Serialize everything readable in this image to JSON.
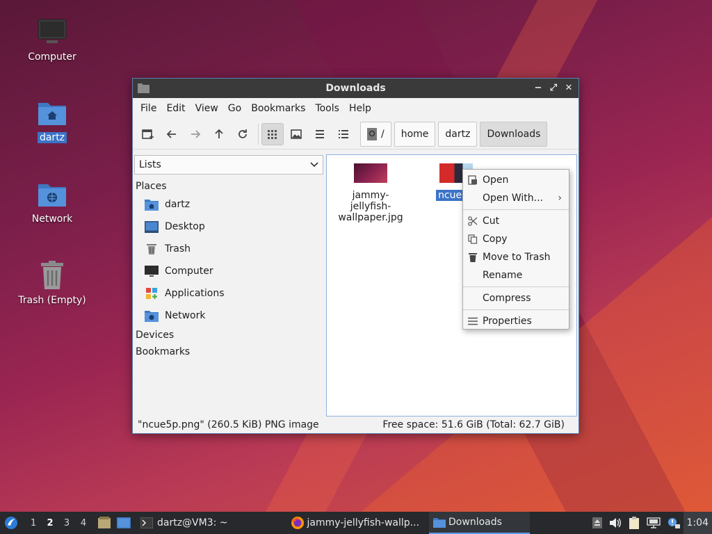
{
  "desktop": {
    "icons": [
      {
        "label": "Computer"
      },
      {
        "label": "dartz"
      },
      {
        "label": "Network"
      },
      {
        "label": "Trash (Empty)"
      }
    ]
  },
  "window": {
    "title": "Downloads",
    "controls": {
      "minimize": "−",
      "maximize": "⤢",
      "close": "✕"
    },
    "menu": [
      "File",
      "Edit",
      "View",
      "Go",
      "Bookmarks",
      "Tools",
      "Help"
    ],
    "path": [
      "/",
      "home",
      "dartz",
      "Downloads"
    ],
    "sidebar": {
      "mode": "Lists",
      "places_heading": "Places",
      "places": [
        {
          "label": "dartz",
          "icon": "home-folder-icon"
        },
        {
          "label": "Desktop",
          "icon": "desktop-icon"
        },
        {
          "label": "Trash",
          "icon": "trash-icon"
        },
        {
          "label": "Computer",
          "icon": "computer-icon"
        },
        {
          "label": "Applications",
          "icon": "applications-icon"
        },
        {
          "label": "Network",
          "icon": "network-folder-icon"
        }
      ],
      "devices_heading": "Devices",
      "bookmarks_heading": "Bookmarks"
    },
    "files": [
      {
        "name_line1": "jammy-jellyfish-",
        "name_line2": "wallpaper.jpg"
      },
      {
        "name": "ncue5p"
      }
    ],
    "status": {
      "left": "\"ncue5p.png\" (260.5 KiB) PNG image",
      "right": "Free space: 51.6 GiB (Total: 62.7 GiB)"
    }
  },
  "context_menu": {
    "open": "Open",
    "open_with": "Open With...",
    "cut": "Cut",
    "copy": "Copy",
    "move_to_trash": "Move to Trash",
    "rename": "Rename",
    "compress": "Compress",
    "properties": "Properties"
  },
  "taskbar": {
    "workspaces": [
      "1",
      "2",
      "3",
      "4"
    ],
    "active_workspace": "2",
    "tasks": [
      {
        "label": "dartz@VM3: ~"
      },
      {
        "label": "jammy-jellyfish-wallp..."
      },
      {
        "label": "Downloads"
      }
    ],
    "clock": "1:04"
  },
  "colors": {
    "selection": "#3b74c8",
    "folder_blue": "#4a86d4",
    "titlebar": "#3a3a3a",
    "taskbar": "#27292c"
  }
}
